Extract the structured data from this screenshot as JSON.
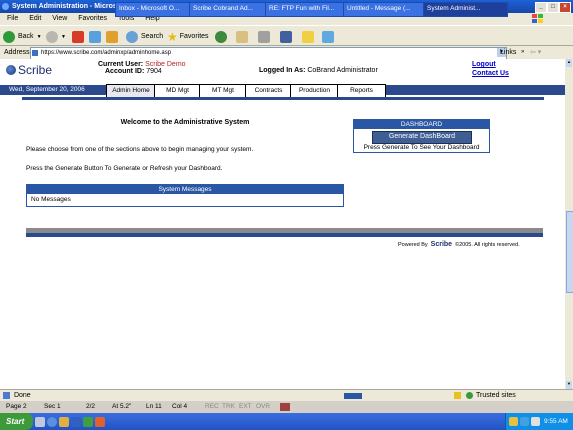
{
  "window": {
    "title": "System Administration - Microsoft Internet Explorer"
  },
  "menu": [
    "File",
    "Edit",
    "View",
    "Favorites",
    "Tools",
    "Help"
  ],
  "toolbar": {
    "back_label": "Back",
    "search_label": "Search",
    "favorites_label": "Favorites"
  },
  "address": {
    "label": "Address",
    "url": "https://www.scribe.com/adminxp/adminhome.asp",
    "links_label": "Links"
  },
  "header": {
    "logo_text": "Scribe",
    "current_user_label": "Current User:",
    "current_user_value": "Scribe Demo",
    "account_id_label": "Account ID:",
    "account_id_value": "7904",
    "logged_in_label": "Logged In As:",
    "logged_in_value": "CoBrand Administrator",
    "logout": "Logout",
    "contact": "Contact Us"
  },
  "nav": {
    "date": "Wed, September 20, 2006",
    "tabs": [
      "Admin Home",
      "MD Mgt",
      "MT Mgt",
      "Contracts",
      "Production",
      "Reports"
    ]
  },
  "main": {
    "welcome_title": "Welcome to the Administrative System",
    "instruction1": "Please choose from one of the sections above to begin managing your system.",
    "instruction2": "Press the Generate Button To Generate or Refresh your Dashboard.",
    "messages_header": "System Messages",
    "messages_body": "No Messages"
  },
  "dashboard": {
    "header": "DASHBOARD",
    "button": "Generate DashBoard",
    "hint": "Press Generate To See Your Dashboard"
  },
  "footer": {
    "powered_by": "Powered By",
    "brand": "Scribe",
    "copyright": "©2005. All rights reserved."
  },
  "statusbar": {
    "status": "Done",
    "zone": "Trusted sites"
  },
  "wordbar": {
    "page": "Page  2",
    "sec": "Sec  1",
    "pages": "2/2",
    "at": "At  5.2\"",
    "ln": "Ln  11",
    "col": "Col  4",
    "rec": "REC",
    "trk": "TRK",
    "ext": "EXT",
    "ovr": "OVR"
  },
  "taskbar": {
    "start": "Start",
    "tasks": [
      "Inbox - Microsoft O...",
      "Scribe Cobrand Ad...",
      "RE: FTP Fun with Fil...",
      "Untitled - Message (...",
      "System Administ..."
    ],
    "clock": "9:55 AM"
  },
  "colors": {
    "nav_blue": "#2b4a8d",
    "panel_blue": "#2a57a3",
    "user_value_red": "#b22222",
    "link_blue": "#0000cc"
  }
}
